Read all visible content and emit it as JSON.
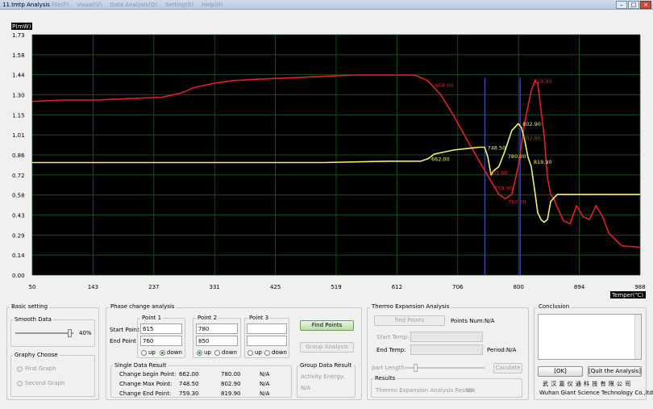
{
  "window": {
    "title": "11.tmtp  Analysis",
    "menu": [
      "File(F)",
      "Visual(V)",
      "Data Analysis(D)",
      "Setting(S)",
      "Help(H)"
    ],
    "controls": [
      "–",
      "□",
      "×"
    ]
  },
  "chart_data": {
    "type": "line",
    "ylabel": "P(mW)",
    "xlabel": "Temper(℃)",
    "ylim": [
      0.0,
      1.73
    ],
    "xlim": [
      50,
      988
    ],
    "y_ticks": [
      "1.73",
      "1.58",
      "1.44",
      "1.30",
      "1.15",
      "1.01",
      "0.86",
      "0.72",
      "0.58",
      "0.43",
      "0.29",
      "0.14",
      "0.00"
    ],
    "x_ticks": [
      "50",
      "143",
      "237",
      "331",
      "425",
      "519",
      "612",
      "706",
      "800",
      "894",
      "988"
    ],
    "grid": true,
    "background": "#000000",
    "series": [
      {
        "color": "#e0202a",
        "x": [
          50,
          100,
          150,
          200,
          250,
          280,
          300,
          330,
          360,
          400,
          450,
          500,
          550,
          600,
          612,
          640,
          660,
          680,
          700,
          720,
          740,
          760,
          770,
          780,
          790,
          800,
          810,
          820,
          826,
          830,
          840,
          845,
          850,
          855,
          860,
          870,
          880,
          890,
          900,
          910,
          920,
          930,
          940,
          960,
          988
        ],
        "y": [
          1.25,
          1.26,
          1.26,
          1.27,
          1.28,
          1.31,
          1.35,
          1.38,
          1.4,
          1.41,
          1.42,
          1.43,
          1.44,
          1.44,
          1.44,
          1.44,
          1.4,
          1.3,
          1.15,
          0.98,
          0.82,
          0.66,
          0.58,
          0.55,
          0.58,
          0.78,
          1.1,
          1.33,
          1.4,
          1.38,
          1.0,
          0.7,
          0.58,
          0.55,
          0.49,
          0.39,
          0.37,
          0.5,
          0.42,
          0.4,
          0.5,
          0.42,
          0.3,
          0.21,
          0.2
        ]
      },
      {
        "color": "#f2f26a",
        "x": [
          50,
          200,
          300,
          400,
          500,
          600,
          640,
          650,
          662,
          670,
          680,
          700,
          720,
          740,
          748,
          753,
          758,
          762,
          770,
          780,
          790,
          800,
          805,
          810,
          815,
          820,
          825,
          830,
          835,
          840,
          845,
          850,
          860,
          870,
          988
        ],
        "y": [
          0.81,
          0.81,
          0.81,
          0.81,
          0.81,
          0.82,
          0.82,
          0.82,
          0.84,
          0.87,
          0.88,
          0.9,
          0.91,
          0.92,
          0.92,
          0.85,
          0.72,
          0.75,
          0.78,
          0.9,
          1.04,
          1.09,
          1.06,
          0.97,
          0.85,
          0.78,
          0.62,
          0.45,
          0.4,
          0.38,
          0.4,
          0.53,
          0.58,
          0.58,
          0.58
        ]
      }
    ],
    "markers": [
      {
        "x": 748.5,
        "color": "#2b3cff"
      },
      {
        "x": 802.9,
        "color": "#2b3cff"
      }
    ],
    "annotations": [
      {
        "text": "662.00",
        "x": 662,
        "y": 0.84,
        "color": "#f2f26a"
      },
      {
        "text": "748.50",
        "x": 748.5,
        "y": 0.92,
        "color": "#f2f26a"
      },
      {
        "text": "780.00",
        "x": 780,
        "y": 0.86,
        "color": "#f2f26a"
      },
      {
        "text": "802.90",
        "x": 802.9,
        "y": 1.09,
        "color": "#f2f26a"
      },
      {
        "text": "819.90",
        "x": 819.9,
        "y": 0.82,
        "color": "#f2f26a"
      },
      {
        "text": "668.00",
        "x": 668,
        "y": 1.37,
        "color": "#e0202a"
      },
      {
        "text": "819.90",
        "x": 819.9,
        "y": 1.4,
        "color": "#e0202a"
      },
      {
        "text": "802.90",
        "x": 802.9,
        "y": 0.99,
        "color": "#e0202a"
      },
      {
        "text": "759.30",
        "x": 759.3,
        "y": 0.63,
        "color": "#e0202a"
      },
      {
        "text": "780.00",
        "x": 780,
        "y": 0.53,
        "color": "#e0202a"
      },
      {
        "text": "751.60",
        "x": 751.6,
        "y": 0.74,
        "color": "#e0202a"
      }
    ]
  },
  "basic": {
    "title": "Basic setting",
    "smooth_title": "Smooth Data",
    "smooth_value": "40%",
    "smooth_fraction": 0.95,
    "graphy_title": "Graphy Choose",
    "first_graph": "First Graph",
    "second_graph": "Second Graph"
  },
  "phase": {
    "title": "Phase change analysis",
    "start_point_label": "Start Point",
    "end_point_label": "End Point",
    "p1": {
      "title": "Point 1",
      "start": "615",
      "end": "760",
      "up": "up",
      "down": "down"
    },
    "p2": {
      "title": "Point 2",
      "start": "780",
      "end": "850",
      "up": "up",
      "down": "down"
    },
    "p3": {
      "title": "Point 3",
      "start": "",
      "end": "",
      "up": "up",
      "down": "down"
    },
    "find_points": "Find Points",
    "group_analysis": "Group Analysis",
    "single_title": "Single Data Result",
    "rows": [
      {
        "label": "Change begin Point:",
        "v1": "662.00",
        "v2": "780.00",
        "v3": "N/A"
      },
      {
        "label": "Change Max Point:",
        "v1": "748.50",
        "v2": "802.90",
        "v3": "N/A"
      },
      {
        "label": "Change End Point:",
        "v1": "759.30",
        "v2": "819.90",
        "v3": "N/A"
      }
    ],
    "group_title": "Group Data Result",
    "activity_label": "Activity Energy:",
    "activity_value": "N/A"
  },
  "thermo": {
    "title": "Thermo Expansion Analysis",
    "find_points": "find Points",
    "points_num_label": "Points Num:",
    "points_num_value": "N/A",
    "start_temp": "Start Temp:",
    "end_temp": "End Temp:",
    "period_label": "Period:",
    "period_value": "N/A",
    "part_length": "part Length:",
    "calculate": "Caculate",
    "results_title": "Results",
    "result_label": "Thermo Expansion Analysis Result:",
    "result_value": "N/A"
  },
  "conclusion": {
    "title": "Conclusion",
    "ok": "[OK]",
    "quit": "[Quit the Analysis]",
    "company_cn": "武 汉 嘉 仪 通 科 技 有 限 公 司",
    "company_en": "Wuhan Giant Science  Technology Co.,ltd"
  }
}
